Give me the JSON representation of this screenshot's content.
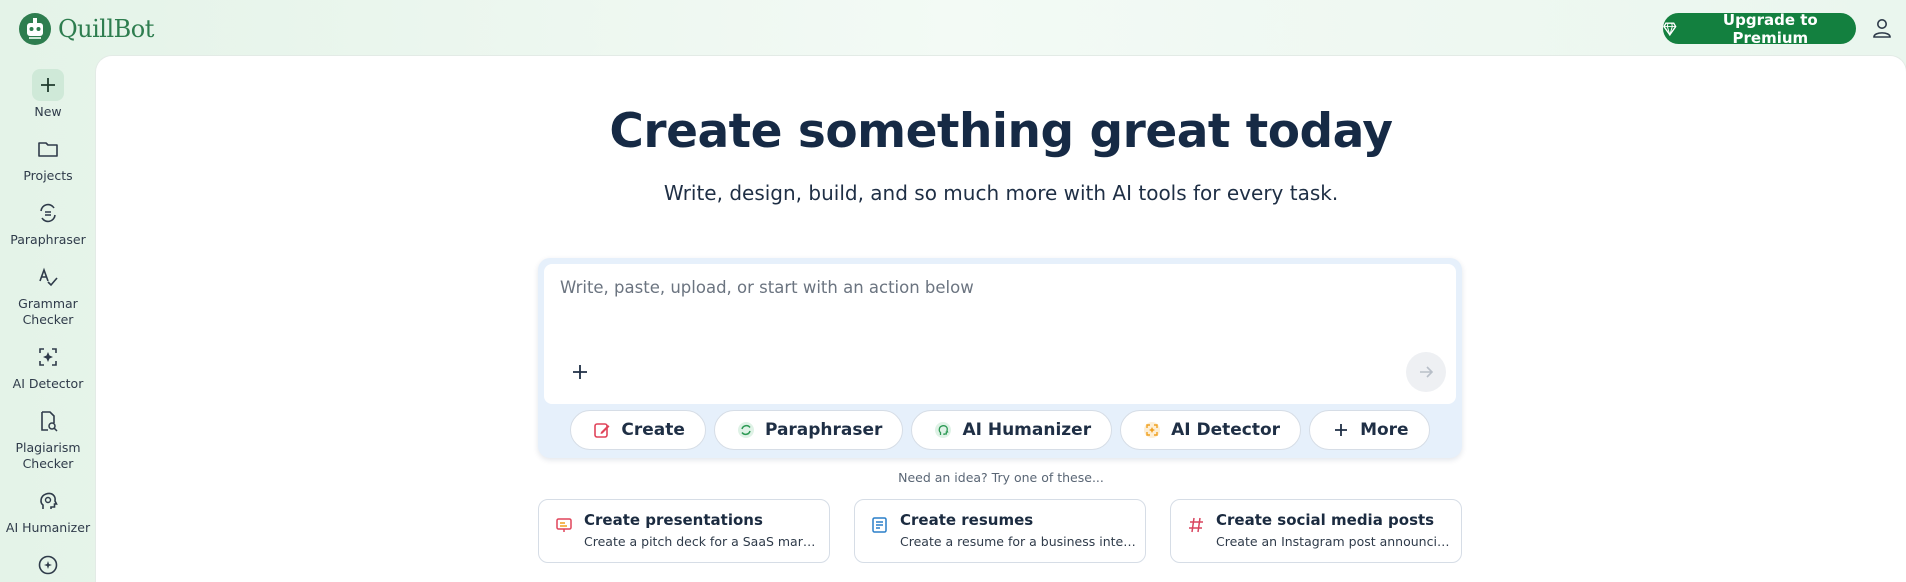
{
  "app": {
    "name": "QuillBot"
  },
  "header": {
    "upgrade_label": "Upgrade to Premium"
  },
  "sidebar": {
    "items": [
      {
        "label": "New",
        "icon": "plus-icon"
      },
      {
        "label": "Projects",
        "icon": "folder-icon"
      },
      {
        "label": "Paraphraser",
        "icon": "paraphraser-icon"
      },
      {
        "label": "Grammar\nChecker",
        "icon": "grammar-check-icon"
      },
      {
        "label": "AI Detector",
        "icon": "ai-detector-icon"
      },
      {
        "label": "Plagiarism\nChecker",
        "icon": "plagiarism-icon"
      },
      {
        "label": "AI Humanizer",
        "icon": "humanizer-icon"
      }
    ]
  },
  "main": {
    "title": "Create something great today",
    "subtitle": "Write, design, build, and so much more with AI tools for every task.",
    "composer": {
      "placeholder": "Write, paste, upload, or start with an action below"
    },
    "chips": [
      {
        "label": "Create",
        "icon": "edit-icon",
        "color": "#e0445a"
      },
      {
        "label": "Paraphraser",
        "icon": "paraphraser-icon",
        "color": "#2e9a55"
      },
      {
        "label": "AI Humanizer",
        "icon": "humanizer-icon",
        "color": "#2e9a55"
      },
      {
        "label": "AI Detector",
        "icon": "ai-detector-icon",
        "color": "#f0a020"
      },
      {
        "label": "More",
        "icon": "plus-icon",
        "color": "#1f2f45"
      }
    ],
    "hint": "Need an idea? Try one of these...",
    "cards": [
      {
        "title": "Create presentations",
        "subtitle": "Create a pitch deck for a SaaS marketin...",
        "icon": "presentation-icon"
      },
      {
        "title": "Create resumes",
        "subtitle": "Create a resume for a business internsh...",
        "icon": "resume-icon"
      },
      {
        "title": "Create social media posts",
        "subtitle": "Create an Instagram post announcing a...",
        "icon": "hashtag-icon"
      }
    ]
  },
  "colors": {
    "brand": "#13803f",
    "title": "#162a45"
  }
}
